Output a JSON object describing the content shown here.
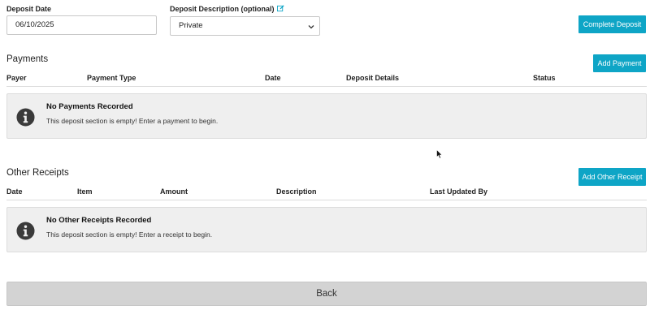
{
  "form": {
    "deposit_date_label": "Deposit Date",
    "deposit_date_value": "06/10/2025",
    "deposit_description_label": "Deposit Description (optional)",
    "deposit_description_value": "Private",
    "complete_button": "Complete Deposit"
  },
  "payments": {
    "title": "Payments",
    "add_button": "Add Payment",
    "columns": [
      "Payer",
      "Payment Type",
      "Date",
      "Deposit Details",
      "Status"
    ],
    "empty_title": "No Payments Recorded",
    "empty_message": "This deposit section is empty! Enter a payment to begin."
  },
  "other_receipts": {
    "title": "Other Receipts",
    "add_button": "Add Other Receipt",
    "columns": [
      "Date",
      "Item",
      "Amount",
      "Description",
      "Last Updated By"
    ],
    "empty_title": "No Other Receipts Recorded",
    "empty_message": "This deposit section is empty! Enter a receipt to begin."
  },
  "footer": {
    "back_button": "Back"
  },
  "icons": {
    "edit": "edit-icon",
    "info": "info-icon",
    "dropdown": "chevron-down-icon",
    "cursor": "mouse-pointer-icon"
  },
  "colors": {
    "accent": "#0ea5c6",
    "empty_box_bg": "#efefef",
    "back_button_bg": "#d3d3d3"
  }
}
